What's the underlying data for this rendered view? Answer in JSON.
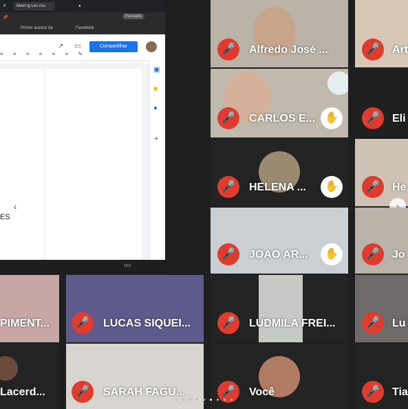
{
  "browser": {
    "tabs": [
      "Meet tg Les rnu"
    ],
    "bookmarks": [
      "Primer acesso da",
      "Facebook"
    ],
    "profile_label": "Pausada"
  },
  "docs": {
    "share_button": "Compartilhar",
    "text_fragment": "ES"
  },
  "taskbar": {
    "time": "13:2"
  },
  "tiles": [
    {
      "name": "Alfredo José ..."
    },
    {
      "name": "Art"
    },
    {
      "name": "CARLOS E..."
    },
    {
      "name": "Eli"
    },
    {
      "name": "HELENA ..."
    },
    {
      "name": "He"
    },
    {
      "name": "JOAO AR..."
    },
    {
      "name": "Jo"
    },
    {
      "name": "PIMENT..."
    },
    {
      "name": "LUCAS SIQUEI..."
    },
    {
      "name": "LUDMILA FREI..."
    },
    {
      "name": "Lu"
    },
    {
      "name": "Lacerd..."
    },
    {
      "name": "SARAH FAGU..."
    },
    {
      "name": "Você"
    },
    {
      "name": "Tia"
    }
  ],
  "colors": {
    "mic_muted": "#e03b2f",
    "tile_bg": "#2d2d2d",
    "share_blue": "#1a73e8"
  },
  "icons": {
    "mic": "mic-off-icon",
    "hand": "raised-hand-icon"
  }
}
